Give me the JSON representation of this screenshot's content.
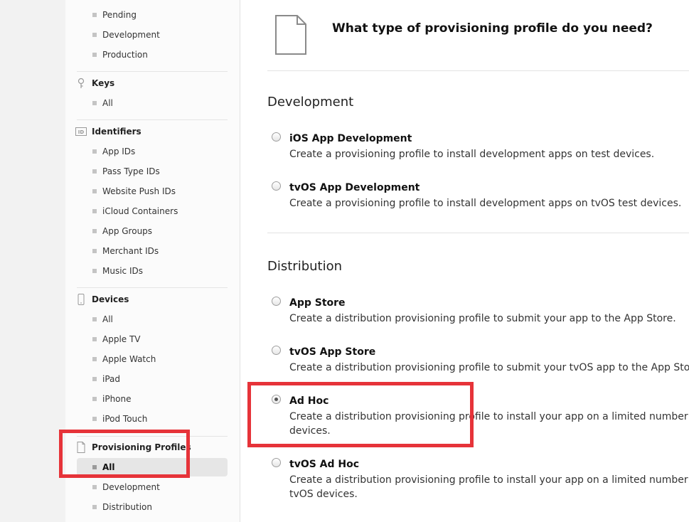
{
  "sidebar": {
    "certificates_items": [
      "Pending",
      "Development",
      "Production"
    ],
    "keys": {
      "title": "Keys",
      "items": [
        "All"
      ]
    },
    "identifiers": {
      "title": "Identifiers",
      "icon_text": "ID",
      "items": [
        "App IDs",
        "Pass Type IDs",
        "Website Push IDs",
        "iCloud Containers",
        "App Groups",
        "Merchant IDs",
        "Music IDs"
      ]
    },
    "devices": {
      "title": "Devices",
      "items": [
        "All",
        "Apple TV",
        "Apple Watch",
        "iPad",
        "iPhone",
        "iPod Touch"
      ]
    },
    "profiles": {
      "title": "Provisioning Profiles",
      "items": [
        "All",
        "Development",
        "Distribution"
      ],
      "active": "All"
    }
  },
  "main": {
    "title": "What type of provisioning profile do you need?",
    "development": {
      "title": "Development",
      "options": [
        {
          "title": "iOS App Development",
          "desc": [
            "Create a provisioning profile to install development apps on test devices."
          ]
        },
        {
          "title": "tvOS App Development",
          "desc": [
            "Create a provisioning profile to install development apps on tvOS test devices."
          ]
        }
      ]
    },
    "distribution": {
      "title": "Distribution",
      "options": [
        {
          "title": "App Store",
          "desc": [
            "Create a distribution provisioning profile to submit your app to the App Store."
          ]
        },
        {
          "title": "tvOS App Store",
          "desc": [
            "Create a distribution provisioning profile to submit your tvOS app to the App Store."
          ]
        },
        {
          "title": "Ad Hoc",
          "desc": [
            "Create a distribution provisioning profile to install your app on a limited number of r",
            "devices."
          ]
        },
        {
          "title": "tvOS Ad Hoc",
          "desc": [
            "Create a distribution provisioning profile to install your app on a limited number of r",
            "tvOS devices."
          ]
        }
      ]
    },
    "selected_option": "Ad Hoc"
  },
  "colors": {
    "highlight": "#e63339",
    "sidebar_bg": "#fbfbfb",
    "active_item_bg": "#e6e6e6"
  }
}
